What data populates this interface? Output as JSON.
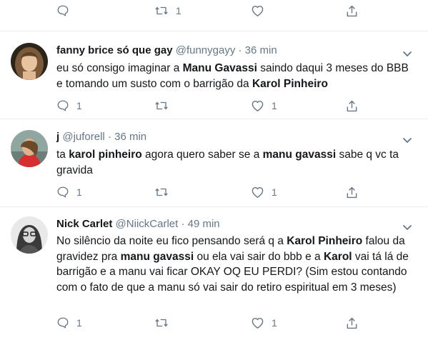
{
  "top_actions": {
    "reply_count": "",
    "retweet_count": "1",
    "like_count": ""
  },
  "tweets": [
    {
      "name": "fanny brice só que gay",
      "handle": "@funnygayy",
      "time": "· 36 min",
      "text": [
        {
          "t": "eu só consigo imaginar a ",
          "b": false
        },
        {
          "t": "Manu Gavassi",
          "b": true
        },
        {
          "t": " saindo daqui 3 meses do BBB e tomando um susto com o barrigão da ",
          "b": false
        },
        {
          "t": "Karol Pinheiro",
          "b": true
        }
      ],
      "reply_count": "1",
      "retweet_count": "",
      "like_count": "1"
    },
    {
      "name": "j",
      "handle": "@juforell",
      "time": "· 36 min",
      "text": [
        {
          "t": "ta ",
          "b": false
        },
        {
          "t": "karol pinheiro",
          "b": true
        },
        {
          "t": " agora quero saber se a ",
          "b": false
        },
        {
          "t": "manu gavassi",
          "b": true
        },
        {
          "t": " sabe q vc ta gravida",
          "b": false
        }
      ],
      "reply_count": "1",
      "retweet_count": "",
      "like_count": "1"
    },
    {
      "name": "Nick Carlet",
      "handle": "@NiickCarlet",
      "time": "· 49 min",
      "text": [
        {
          "t": "No silêncio da noite eu fico pensando será q a ",
          "b": false
        },
        {
          "t": "Karol Pinheiro",
          "b": true
        },
        {
          "t": " falou da gravidez pra ",
          "b": false
        },
        {
          "t": "manu gavassi",
          "b": true
        },
        {
          "t": " ou ela vai sair do bbb e a ",
          "b": false
        },
        {
          "t": "Karol",
          "b": true
        },
        {
          "t": " vai tá lá de barrigão e a manu vai ficar OKAY OQ EU PERDI? (Sim estou contando com o fato de que a manu só vai sair do retiro espiritual em 3 meses)",
          "b": false
        }
      ],
      "reply_count": "1",
      "retweet_count": "",
      "like_count": "1"
    }
  ],
  "icons": {
    "reply": "reply-icon",
    "retweet": "retweet-icon",
    "like": "heart-icon",
    "share": "share-icon",
    "menu": "chevron-down-icon"
  },
  "colors": {
    "text": "#14171a",
    "muted": "#657786",
    "divider": "#e6ecf0"
  }
}
